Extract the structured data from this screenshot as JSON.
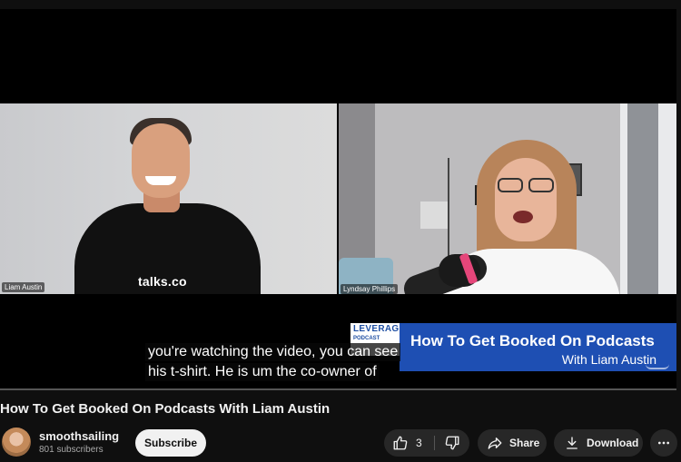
{
  "video": {
    "left_speaker_tag": "Liam Austin",
    "right_speaker_tag": "Lyndsay Phillips",
    "shirt_logo": "talks.co",
    "banner_logo_line1": "LEVERAGE",
    "banner_logo_line2": "PODCAST",
    "banner_title": "How To Get Booked On Podcasts",
    "banner_subtitle": "With Liam Austin",
    "caption_line1": "you're watching the video, you can see",
    "caption_line2": "his t-shirt. He is um the co-owner of"
  },
  "title": "How To Get Booked On Podcasts With Liam Austin",
  "channel": {
    "name": "smoothsailing",
    "subscribers": "801 subscribers",
    "subscribe_label": "Subscribe"
  },
  "actions": {
    "like_count": "3",
    "share_label": "Share",
    "download_label": "Download"
  },
  "icons": {
    "like": "thumbs-up-icon",
    "dislike": "thumbs-down-icon",
    "share": "share-arrow-icon",
    "download": "download-icon",
    "more": "more-horizontal-icon"
  },
  "colors": {
    "banner_blue": "#1e4fb3",
    "mic_accent": "#e5467a",
    "page_bg": "#0f0f0f"
  }
}
